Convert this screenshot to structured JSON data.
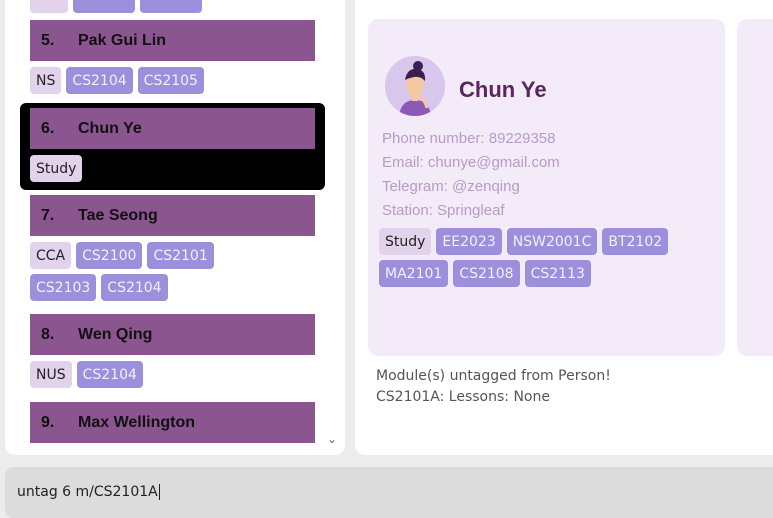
{
  "persons": [
    {
      "index": "5.",
      "name": "Pak Gui Lin",
      "groups": [
        "NS"
      ],
      "modules": [
        "CS2104",
        "CS2105"
      ]
    },
    {
      "index": "6.",
      "name": "Chun Ye",
      "groups": [
        "Study"
      ],
      "modules": []
    },
    {
      "index": "7.",
      "name": "Tae Seong",
      "groups": [
        "CCA"
      ],
      "modules": [
        "CS2100",
        "CS2101",
        "CS2103",
        "CS2104"
      ]
    },
    {
      "index": "8.",
      "name": "Wen Qing",
      "groups": [
        "NUS"
      ],
      "modules": [
        "CS2104"
      ]
    },
    {
      "index": "9.",
      "name": "Max Wellington",
      "groups": [],
      "modules": []
    }
  ],
  "detail": {
    "name": "Chun Ye",
    "phone": "Phone number: 89229358",
    "email": "Email: chunye@gmail.com",
    "telegram": "Telegram: @zenqing",
    "station": "Station: Springleaf",
    "group_tag": "Study",
    "modules": [
      "EE2023",
      "NSW2001C",
      "BT2102",
      "MA2101",
      "CS2108",
      "CS2113"
    ]
  },
  "result": {
    "line1": "Module(s) untagged from Person!",
    "line2": "CS2101A: Lessons: None"
  },
  "command": {
    "value": "untag 6 m/CS2101A"
  },
  "colors": {
    "name_bar": "#8b5590",
    "group_tag": "#e2d2ec",
    "module_tag": "#9c8fdc",
    "detail_bg": "#f3ecf8",
    "detail_name": "#5a2560"
  }
}
